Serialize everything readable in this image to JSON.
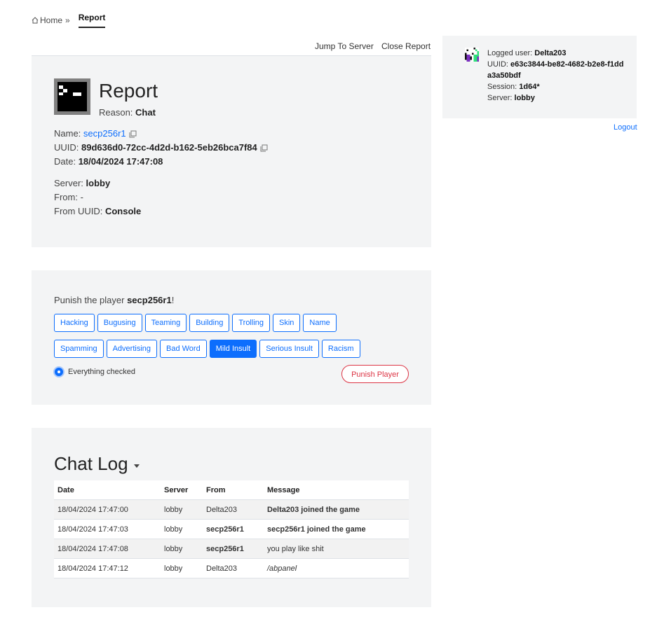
{
  "breadcrumb": {
    "home": "Home",
    "separator": "»",
    "current": "Report"
  },
  "toolbar": {
    "jump": "Jump To Server",
    "close": "Close Report"
  },
  "report": {
    "title": "Report",
    "reason_label": "Reason:",
    "reason_value": "Chat",
    "name_label": "Name:",
    "name_value": "secp256r1",
    "uuid_label": "UUID:",
    "uuid_value": "89d636d0-72cc-4d2d-b162-5eb26bca7f84",
    "date_label": "Date:",
    "date_value": "18/04/2024 17:47:08",
    "server_label": "Server:",
    "server_value": "lobby",
    "from_label": "From:",
    "from_value": "-",
    "from_uuid_label": "From UUID:",
    "from_uuid_value": "Console"
  },
  "punish": {
    "prefix": "Punish the player",
    "player": "secp256r1",
    "suffix": "!",
    "reasons_row1": [
      "Hacking",
      "Bugusing",
      "Teaming",
      "Building",
      "Trolling",
      "Skin",
      "Name"
    ],
    "reasons_row2": [
      "Spamming",
      "Advertising",
      "Bad Word",
      "Mild Insult",
      "Serious Insult",
      "Racism"
    ],
    "selected": "Mild Insult",
    "radio_label": "Everything checked",
    "button": "Punish Player"
  },
  "chat_log": {
    "title": "Chat Log",
    "columns": [
      "Date",
      "Server",
      "From",
      "Message"
    ],
    "rows": [
      {
        "date": "18/04/2024 17:47:00",
        "server": "lobby",
        "from": "Delta203",
        "message": "Delta203 joined the game"
      },
      {
        "date": "18/04/2024 17:47:03",
        "server": "lobby",
        "from": "secp256r1",
        "message": "secp256r1 joined the game"
      },
      {
        "date": "18/04/2024 17:47:08",
        "server": "lobby",
        "from": "secp256r1",
        "message": "you play like shit"
      },
      {
        "date": "18/04/2024 17:47:12",
        "server": "lobby",
        "from": "Delta203",
        "message": "/abpanel"
      }
    ]
  },
  "user": {
    "logged_label": "Logged user:",
    "logged_value": "Delta203",
    "uuid_label": "UUID:",
    "uuid_value": "e63c3844-be82-4682-b2e8-f1dda3a50bdf",
    "session_label": "Session:",
    "session_value": "1d64*",
    "server_label": "Server:",
    "server_value": "lobby",
    "logout": "Logout"
  },
  "colors": {
    "primary": "#0d6efd",
    "danger": "#dc3545",
    "panel": "#f3f4f5"
  }
}
